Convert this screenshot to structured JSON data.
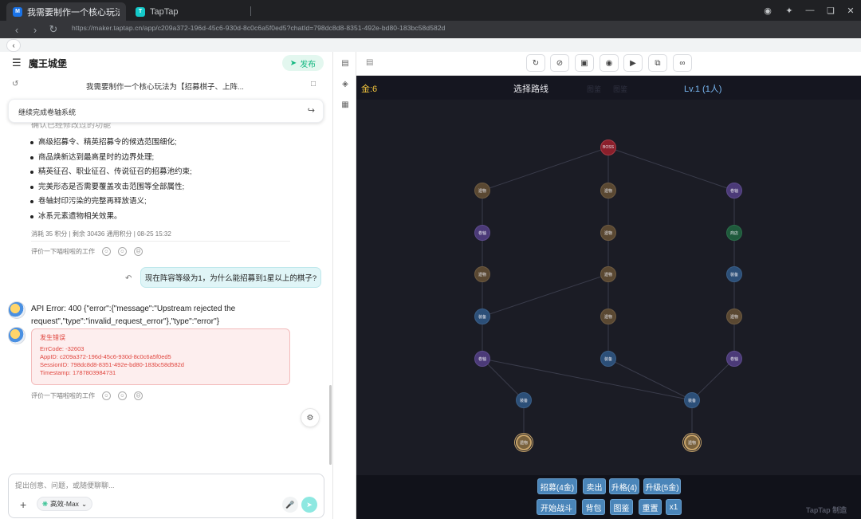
{
  "browser": {
    "tabs": [
      {
        "label": "我需要制作一个核心玩法为【招募",
        "favicon": "M",
        "active": true
      },
      {
        "label": "TapTap",
        "favicon": "T",
        "active": false
      }
    ],
    "url": "https://maker.taptap.cn/app/c209a372-196d-45c6-930d-8c0c6a5f0ed5?chatId=798dc8d8-8351-492e-bd80-183bc58d582d"
  },
  "chat": {
    "title": "魔王城堡",
    "publish_label": "发布",
    "subtitle": "我需要制作一个核心玩法为【招募棋子、上阵...",
    "pill_text": "继续完成卷轴系统",
    "partial_line": "确认已经修改过的功能",
    "bullets": [
      "高级招募令、精英招募令的候选范围细化;",
      "商品焕新达到最高星时的边界处理;",
      "精英征召、职业征召、传说征召的招募池约束;",
      "完美形态是否需要覆盖攻击范围等全部属性;",
      "卷轴封印污染的完整再释放语义;",
      "冰系元素遗物相关效果。"
    ],
    "meta": "消耗 35 积分 | 剩余 30436 通用积分 | 08-25 15:32",
    "rate_label": "评价一下喵啦啦的工作",
    "user_message": "现在阵容等级为1，为什么能招募到1星以上的棋子?",
    "api_error": "API Error: 400 {\"error\":{\"message\":\"Upstream rejected the request\",\"type\":\"invalid_request_error\"},\"type\":\"error\"}",
    "error_box": {
      "title": "发生错误",
      "lines": [
        "ErrCode: -32603",
        "AppID: c209a372-196d-45c6-930d-8c0c6a5f0ed5",
        "SessionID: 798dc8d8-8351-492e-bd80-183bc58d582d",
        "Timestamp: 1787803984731"
      ]
    },
    "composer_placeholder": "提出创意、问题，或随便聊聊...",
    "model_label": "高效-Max"
  },
  "game": {
    "gold": "金:6",
    "route_title": "选择路线",
    "ghost_tabs": [
      "图鉴",
      "图鉴"
    ],
    "level": "Lv.1 (1人)",
    "node_labels": {
      "boss": "BOSS",
      "relic": "遗物",
      "scroll": "卷轴",
      "shop": "商店",
      "equip": "装备"
    },
    "buttons_row1": [
      "招募(4金)",
      "卖出",
      "升格(4)",
      "升级(5金)"
    ],
    "buttons_row2": [
      "开始战斗",
      "背包",
      "图鉴",
      "重置",
      "x1"
    ],
    "watermark": "TapTap 制造"
  },
  "colors": {
    "accent": "#14b881",
    "game_bg": "#1b1c25",
    "gold": "#f3c53d",
    "level": "#78b7f2",
    "button": "#4a85b9",
    "error": "#e0463f"
  }
}
